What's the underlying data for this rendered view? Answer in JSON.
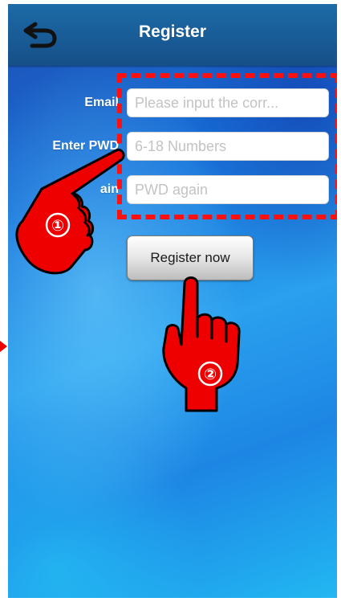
{
  "header": {
    "title": "Register",
    "back_icon": "back-arrow-icon"
  },
  "form": {
    "email": {
      "label": "Email",
      "placeholder": "Please input the corr..."
    },
    "password": {
      "label": "Enter PWD",
      "placeholder": "6-18 Numbers"
    },
    "confirm": {
      "label": "Again",
      "label_visible": "ain",
      "placeholder": "PWD again"
    }
  },
  "actions": {
    "register_label": "Register now"
  },
  "annotations": {
    "step1": "①",
    "step2": "②",
    "highlight_color": "#ff1010",
    "hand_color": "#ee0000"
  }
}
